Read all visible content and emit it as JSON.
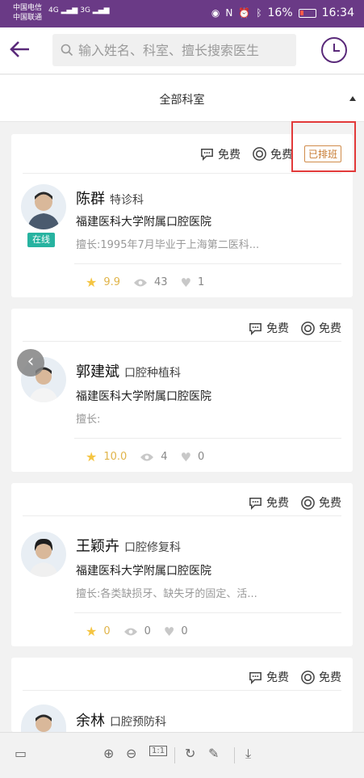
{
  "status_bar": {
    "carrier1": "中国电信",
    "carrier2": "中国联通",
    "network1": "4G",
    "network2": "3G",
    "battery": "16%",
    "time": "16:34"
  },
  "search": {
    "placeholder": "输入姓名、科室、擅长搜索医生"
  },
  "filter": {
    "department": "全部科室"
  },
  "doctors": [
    {
      "name": "陈群",
      "dept": "特诊科",
      "hospital": "福建医科大学附属口腔医院",
      "specialty": "擅长:1995年7月毕业于上海第二医科...",
      "online": "在线",
      "fee1": "免费",
      "fee2": "免费",
      "schedule_badge": "已排班",
      "rating": "9.9",
      "views": "43",
      "likes": "1"
    },
    {
      "name": "郭建斌",
      "dept": "口腔种植科",
      "hospital": "福建医科大学附属口腔医院",
      "specialty": "擅长:",
      "fee1": "免费",
      "fee2": "免费",
      "rating": "10.0",
      "views": "4",
      "likes": "0"
    },
    {
      "name": "王颖卉",
      "dept": "口腔修复科",
      "hospital": "福建医科大学附属口腔医院",
      "specialty": "擅长:各类缺损牙、缺失牙的固定、活...",
      "fee1": "免费",
      "fee2": "免费",
      "rating": "0",
      "views": "0",
      "likes": "0"
    },
    {
      "name": "余林",
      "dept": "口腔预防科",
      "fee1": "免费",
      "fee2": "免费"
    }
  ],
  "toolbar": {
    "page_indicator": "1:1"
  },
  "colors": {
    "brand": "#6a3a86",
    "accent_online": "#27b3a0",
    "highlight_box": "#e23a3a",
    "badge": "#c77a30"
  }
}
